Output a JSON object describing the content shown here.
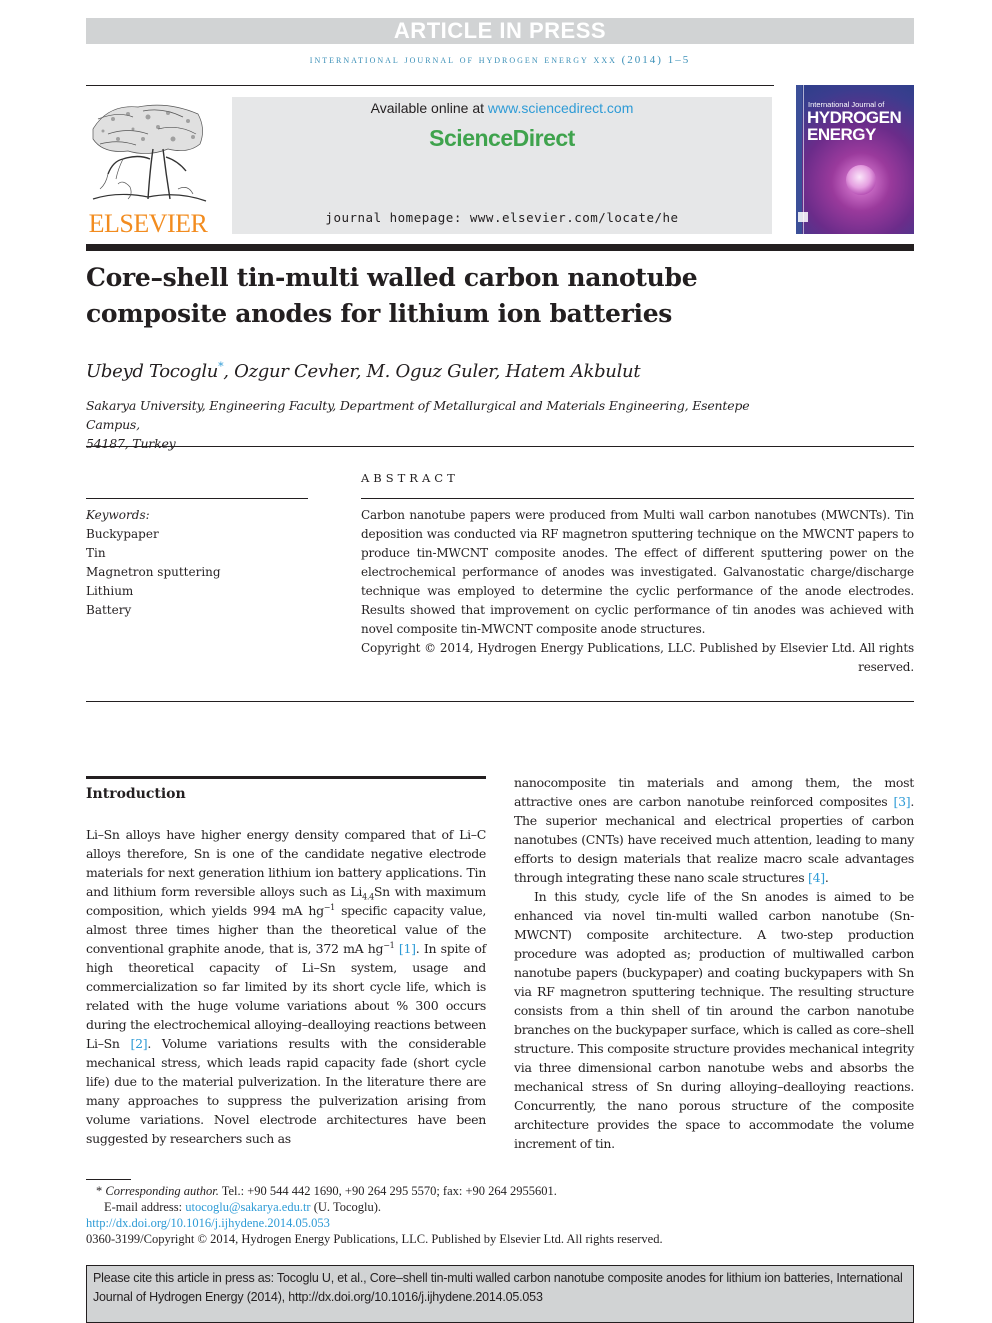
{
  "header": {
    "banner": "ARTICLE IN PRESS",
    "journal_line": "INTERNATIONAL JOURNAL OF HYDROGEN ENERGY XXX (2014) 1–5",
    "publisher_logo_text": "ELSEVIER",
    "available_online_prefix": "Available online at ",
    "available_online_link": "www.sciencedirect.com",
    "sciencedirect_brand": "ScienceDirect",
    "journal_homepage": "journal homepage: www.elsevier.com/locate/he",
    "cover": {
      "line1": "International Journal of",
      "line2": "HYDROGEN",
      "line3": "ENERGY"
    }
  },
  "article": {
    "title_line1": "Core–shell tin-multi walled carbon nanotube",
    "title_line2": "composite anodes for lithium ion batteries",
    "authors": [
      {
        "name": "Ubeyd Tocoglu",
        "corresponding": true
      },
      {
        "name": "Ozgur Cevher"
      },
      {
        "name": "M. Oguz Guler"
      },
      {
        "name": "Hatem Akbulut"
      }
    ],
    "corresponding_mark": "*",
    "affiliation_line1": "Sakarya University, Engineering Faculty, Department of Metallurgical and Materials Engineering, Esentepe Campus,",
    "affiliation_line2": "54187, Turkey"
  },
  "keywords": {
    "label": "Keywords:",
    "items": [
      "Buckypaper",
      "Tin",
      "Magnetron sputtering",
      "Lithium",
      "Battery"
    ]
  },
  "abstract": {
    "heading": "ABSTRACT",
    "text": "Carbon nanotube papers were produced from Multi wall carbon nanotubes (MWCNTs). Tin deposition was conducted via RF magnetron sputtering technique on the MWCNT papers to produce tin-MWCNT composite anodes. The effect of different sputtering power on the electrochemical performance of anodes was investigated. Galvanostatic charge/discharge technique was employed to determine the cyclic performance of the anode electrodes. Results showed that improvement on cyclic performance of tin anodes was achieved with novel composite tin-MWCNT composite anode structures.",
    "copyright": "Copyright © 2014, Hydrogen Energy Publications, LLC. Published by Elsevier Ltd. All rights reserved."
  },
  "introduction": {
    "heading": "Introduction",
    "left": {
      "p1_a": "Li–Sn alloys have higher energy density compared that of Li–C alloys therefore, Sn is one of the candidate negative electrode materials for next generation lithium ion battery applications. Tin and lithium form reversible alloys such as Li",
      "p1_sub": "4.4",
      "p1_b": "Sn with maximum composition, which yields 994 mA hg",
      "p1_sup1": "−1",
      "p1_c": " specific capacity value, almost three times higher than the theoretical value of the conventional graphite anode, that is, 372 mA hg",
      "p1_sup2": "−1",
      "p1_ref1": "[1]",
      "p1_d": ". In spite of high theoretical capacity of Li–Sn system, usage and commercialization so far limited by its short cycle life, which is related with the huge volume variations about % 300 occurs during the electrochemical alloying–dealloying reactions between Li–Sn ",
      "p1_ref2": "[2]",
      "p1_e": ". Volume variations results with the considerable mechanical stress, which leads rapid capacity fade (short cycle life) due to the material pulverization. In the literature there are many approaches to suppress the pulverization arising from volume variations. Novel electrode architectures have been suggested by researchers such as"
    },
    "right": {
      "p1_a": "nanocomposite tin materials and among them, the most attractive ones are carbon nanotube reinforced composites ",
      "p1_ref3": "[3]",
      "p1_b": ". The superior mechanical and electrical properties of carbon nanotubes (CNTs) have received much attention, leading to many efforts to design materials that realize macro scale advantages through integrating these nano scale structures ",
      "p1_ref4": "[4]",
      "p1_c": ".",
      "p2": "In this study, cycle life of the Sn anodes is aimed to be enhanced via novel tin-multi walled carbon nanotube (Sn-MWCNT) composite architecture. A two-step production procedure was adopted as; production of multiwalled carbon nanotube papers (buckypaper) and coating buckypapers with Sn via RF magnetron sputtering technique. The resulting structure consists from a thin shell of tin around the carbon nanotube branches on the buckypaper surface, which is called as core–shell structure. This composite structure provides mechanical integrity via three dimensional carbon nanotube webs and absorbs the mechanical stress of Sn during alloying–dealloying reactions. Concurrently, the nano porous structure of the composite architecture provides the space to accommodate the volume increment of tin."
    }
  },
  "footnotes": {
    "star": "*",
    "corresponding_label": "Corresponding author.",
    "phones": " Tel.: +90 544 442 1690, +90 264 295 5570; fax: +90 264 2955601.",
    "email_label": "E-mail address: ",
    "email": "utocoglu@sakarya.edu.tr",
    "email_suffix": " (U. Tocoglu).",
    "doi_link": "http://dx.doi.org/10.1016/j.ijhydene.2014.05.053",
    "issn_copyright": "0360-3199/Copyright © 2014, Hydrogen Energy Publications, LLC. Published by Elsevier Ltd. All rights reserved."
  },
  "citation_box": {
    "text": "Please cite this article in press as: Tocoglu U, et al., Core–shell tin-multi walled carbon nanotube composite anodes for lithium ion batteries, International Journal of Hydrogen Energy (2014), http://dx.doi.org/10.1016/j.ijhydene.2014.05.053"
  },
  "colors": {
    "link": "#2e9bd6",
    "journal_line": "#3a8fb7",
    "sciencedirect_green": "#3fa34d",
    "elsevier_orange": "#f28c1f",
    "banner_gray": "#d1d3d4"
  }
}
